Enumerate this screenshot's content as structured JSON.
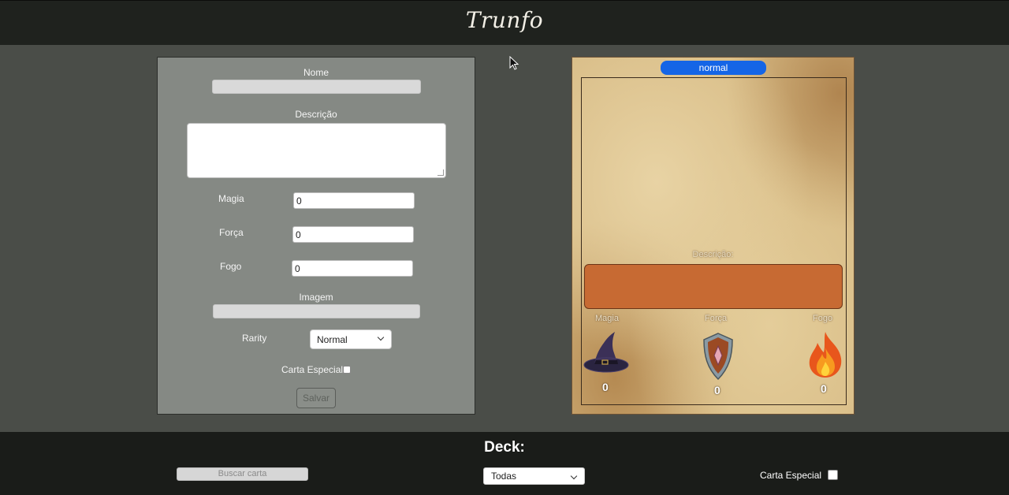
{
  "header": {
    "title": "Trunfo"
  },
  "form": {
    "name_label": "Nome",
    "name_value": "",
    "description_label": "Descrição",
    "description_value": "",
    "magia_label": "Magia",
    "magia_value": "0",
    "forca_label": "Força",
    "forca_value": "0",
    "fogo_label": "Fogo",
    "fogo_value": "0",
    "image_label": "Imagem",
    "image_value": "",
    "rarity_label": "Rarity",
    "rarity_value": "Normal",
    "special_label": "Carta Especial",
    "special_checked": false,
    "save_label": "Salvar"
  },
  "card": {
    "rarity": "normal",
    "description_label": "Descrição:",
    "stats": [
      {
        "label": "Magia",
        "value": "0",
        "icon": "wizard-hat-icon"
      },
      {
        "label": "Força",
        "value": "0",
        "icon": "shield-icon"
      },
      {
        "label": "Fogo",
        "value": "0",
        "icon": "fire-icon"
      }
    ]
  },
  "footer": {
    "deck_title": "Deck:",
    "search_placeholder": "Buscar carta",
    "filter_value": "Todas",
    "special_label": "Carta Especial",
    "special_checked": false
  },
  "colors": {
    "header_bg": "#1f221e",
    "page_bg": "#4a4d48",
    "form_bg": "#858984",
    "rarity_pill": "#1565e6",
    "card_desc_box": "#c76a33"
  }
}
